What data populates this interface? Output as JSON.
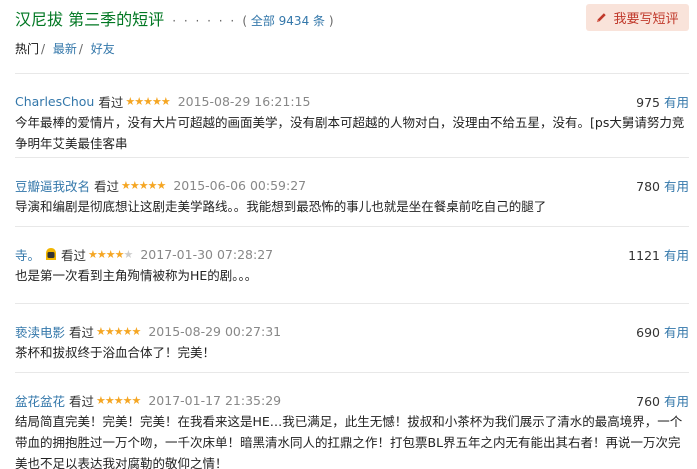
{
  "header": {
    "title": "汉尼拔 第三季的短评",
    "dots": "· · · · · ·",
    "total_prefix": "( ",
    "total_link": "全部 9434 条",
    "total_suffix": " )",
    "write_button": "我要写短评"
  },
  "tabs": [
    {
      "label": "热门",
      "sep": "/"
    },
    {
      "label": "最新",
      "sep": "/"
    },
    {
      "label": "好友",
      "sep": ""
    }
  ],
  "reviews": [
    {
      "user": "CharlesChou",
      "status": "看过",
      "stars": "★★★★★",
      "stars_off": "",
      "rating": 5,
      "time": "2015-08-29 16:21:15",
      "votes": "975",
      "useful": "有用",
      "content": "今年最棒的爱情片，没有大片可超越的画面美学，没有剧本可超越的人物对白，没理由不给五星，没有。[ps大舅请努力竞争明年艾美最佳客串"
    },
    {
      "user": "豆瓣逼我改名",
      "status": "看过",
      "stars": "★★★★★",
      "stars_off": "",
      "rating": 5,
      "time": "2015-06-06 00:59:27",
      "votes": "780",
      "useful": "有用",
      "content": "导演和编剧是彻底想让这剧走美学路线。。我能想到最恐怖的事儿也就是坐在餐桌前吃自己的腿了"
    },
    {
      "user": "寺。",
      "status": "看过",
      "stars": "★★★★",
      "stars_off": "★",
      "rating": 4,
      "time": "2017-01-30 07:28:27",
      "votes": "1121",
      "useful": "有用",
      "content": "也是第一次看到主角殉情被称为HE的剧。。。"
    },
    {
      "user": "亵渎电影",
      "status": "看过",
      "stars": "★★★★★",
      "stars_off": "",
      "rating": 5,
      "time": "2015-08-29 00:27:31",
      "votes": "690",
      "useful": "有用",
      "content": "茶杯和拔叔终于浴血合体了！完美！"
    },
    {
      "user": "盆花盆花",
      "status": "看过",
      "stars": "★★★★★",
      "stars_off": "",
      "rating": 5,
      "time": "2017-01-17 21:35:29",
      "votes": "760",
      "useful": "有用",
      "content": "结局简直完美！完美！完美！在我看来这是HE…我已满足，此生无憾！拔叔和小茶杯为我们展示了清水的最高境界，一个带血的拥抱胜过一万个吻，一千次床单！暗黑清水同人的扛鼎之作！打包票BL界五年之内无有能出其右者！再说一万次完美也不足以表达我对腐勒的敬仰之情！"
    }
  ],
  "colors": {
    "title": "#007722",
    "link": "#3377aa",
    "star": "#f5a623",
    "button_bg": "#f9e3da",
    "button_text": "#c0392b"
  },
  "icons": {
    "write_button_icon": "pencil-icon",
    "user_badge_icon": "avatar-badge-icon"
  }
}
